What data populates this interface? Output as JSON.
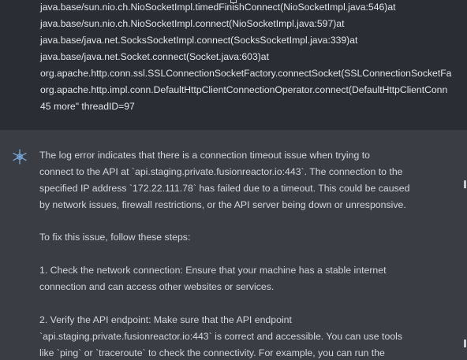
{
  "stack_trace": {
    "lines": [
      "java.base/sun.nio.ch.NioSocketImpl.timedFinishConnect(NioSocketImpl.java:546)at",
      "java.base/sun.nio.ch.NioSocketImpl.connect(NioSocketImpl.java:597)at",
      "java.base/java.net.SocksSocketImpl.connect(SocksSocketImpl.java:339)at",
      "java.base/java.net.Socket.connect(Socket.java:603)at",
      "org.apache.http.conn.ssl.SSLConnectionSocketFactory.connectSocket(SSLConnectionSocketFa",
      "org.apache.http.impl.conn.DefaultHttpClientConnectionOperator.connect(DefaultHttpClientConn",
      "45 more\" threadID=97"
    ]
  },
  "answer": {
    "icon": "assistant-sparkle-icon",
    "lines": [
      "The log error indicates that there is a connection timeout issue when trying to",
      "connect to the API at `api.staging.private.fusionreactor.io:443`. The connection to the",
      "specified IP address `172.22.111.78` has failed due to a timeout. This could be caused",
      "by network issues, firewall restrictions, or the API server being down or unresponsive.",
      "To fix this issue, follow these steps:",
      "1. Check the network connection: Ensure that your machine has a stable internet",
      "connection and can access other websites or services.",
      "2. Verify the API endpoint: Make sure that the API endpoint",
      "`api.staging.private.fusionreactor.io:443` is correct and accessible. You can use tools",
      "like `ping` or `traceroute` to check the connectivity. For example, you can run the"
    ]
  }
}
